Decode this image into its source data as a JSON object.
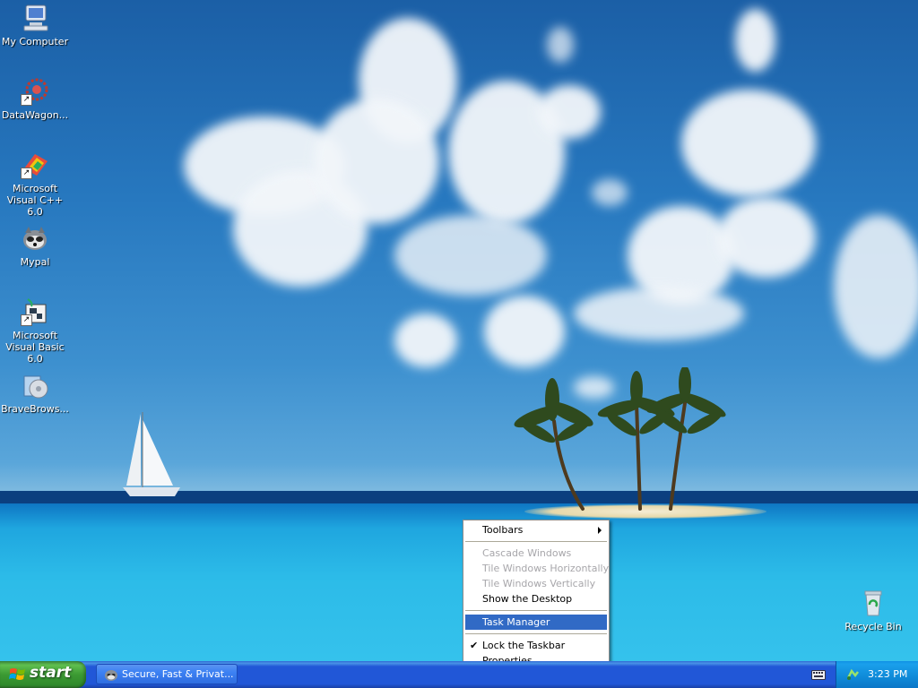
{
  "desktop": {
    "icons": [
      {
        "label": "My Computer",
        "icon": "my-computer-icon"
      },
      {
        "label": "DataWagon...",
        "icon": "datawagon-icon"
      },
      {
        "label": "Microsoft Visual C++ 6.0",
        "icon": "visual-cpp-icon"
      },
      {
        "label": "Mypal",
        "icon": "mypal-icon"
      },
      {
        "label": "Microsoft Visual Basic 6.0",
        "icon": "visual-basic-icon"
      },
      {
        "label": "BraveBrows...",
        "icon": "bravebrowser-icon"
      }
    ],
    "recycle_bin": {
      "label": "Recycle Bin",
      "icon": "recycle-bin-icon"
    }
  },
  "context_menu": {
    "items": [
      {
        "label": "Toolbars",
        "state": "enabled",
        "submenu": true
      },
      {
        "label": "Cascade Windows",
        "state": "disabled"
      },
      {
        "label": "Tile Windows Horizontally",
        "state": "disabled"
      },
      {
        "label": "Tile Windows Vertically",
        "state": "disabled"
      },
      {
        "label": "Show the Desktop",
        "state": "enabled"
      },
      {
        "label": "Task Manager",
        "state": "highlighted"
      },
      {
        "label": "Lock the Taskbar",
        "state": "checked"
      },
      {
        "label": "Properties",
        "state": "enabled"
      }
    ]
  },
  "taskbar": {
    "start_label": "start",
    "task_button_label": "Secure, Fast & Privat...",
    "clock": "3:23 PM"
  },
  "colors": {
    "taskbar_blue": "#2157d7",
    "start_green": "#3c9a33",
    "menu_highlight": "#316ac5",
    "disabled_text": "#a7a6aa"
  }
}
